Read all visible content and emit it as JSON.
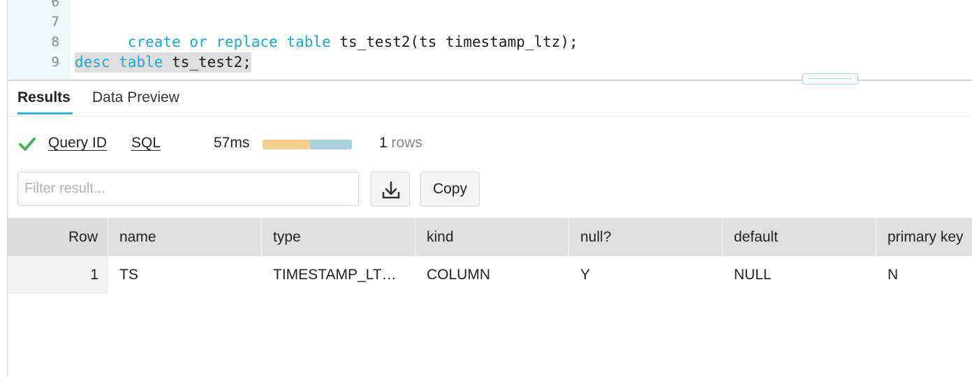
{
  "editor": {
    "lines": [
      {
        "num": "6",
        "tokens": []
      },
      {
        "num": "7",
        "tokens": [
          {
            "text": "create",
            "kw": true
          },
          {
            "text": " ",
            "kw": false
          },
          {
            "text": "or",
            "kw": true
          },
          {
            "text": " ",
            "kw": false
          },
          {
            "text": "replace",
            "kw": true
          },
          {
            "text": " ",
            "kw": false
          },
          {
            "text": "table",
            "kw": true
          },
          {
            "text": " ts_test2(ts timestamp_ltz);",
            "kw": false
          }
        ]
      },
      {
        "num": "8",
        "tokens": []
      },
      {
        "num": "9",
        "selected": true,
        "tokens": [
          {
            "text": "desc",
            "kw": true
          },
          {
            "text": " ",
            "kw": false
          },
          {
            "text": "table",
            "kw": true
          },
          {
            "text": " ts_test2;",
            "kw": false
          }
        ]
      }
    ]
  },
  "tabs": {
    "results": "Results",
    "data_preview": "Data Preview",
    "active": "results"
  },
  "status": {
    "icon": "check-icon",
    "success_color": "#4caf50",
    "query_id_label": "Query ID",
    "sql_label": "SQL",
    "duration": "57ms",
    "timing_fraction_first": 0.53,
    "row_count": "1",
    "rows_label": "rows"
  },
  "toolbar": {
    "filter_placeholder": "Filter result...",
    "download_icon": "download-icon",
    "copy_label": "Copy"
  },
  "table": {
    "columns": [
      "Row",
      "name",
      "type",
      "kind",
      "null?",
      "default",
      "primary key"
    ],
    "rows": [
      [
        "1",
        "TS",
        "TIMESTAMP_LT…",
        "COLUMN",
        "Y",
        "NULL",
        "N"
      ]
    ]
  }
}
